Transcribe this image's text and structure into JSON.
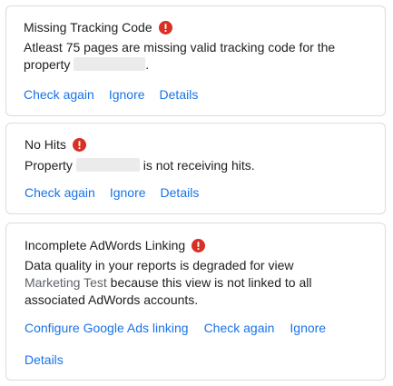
{
  "cards": [
    {
      "title": "Missing Tracking Code",
      "body_pre": "Atleast 75 pages are missing valid tracking code for the property ",
      "body_post": ".",
      "actions": [
        "Check again",
        "Ignore",
        "Details"
      ]
    },
    {
      "title": "No Hits",
      "body_pre": "Property ",
      "body_post": " is not receiving hits.",
      "actions": [
        "Check again",
        "Ignore",
        "Details"
      ]
    },
    {
      "title": "Incomplete AdWords Linking",
      "body_pre": "Data quality in your reports is degraded for view",
      "view_name": "Marketing Test",
      "body_post": " because this view is not linked to all associated AdWords accounts.",
      "actions": [
        "Configure Google Ads linking",
        "Check again",
        "Ignore",
        "Details"
      ]
    }
  ],
  "colors": {
    "link": "#1a73e8",
    "alert": "#d93025",
    "border": "#dadce0",
    "text": "#202124",
    "muted": "#5f6368"
  },
  "icons": {
    "alert": "alert-circle-icon"
  }
}
